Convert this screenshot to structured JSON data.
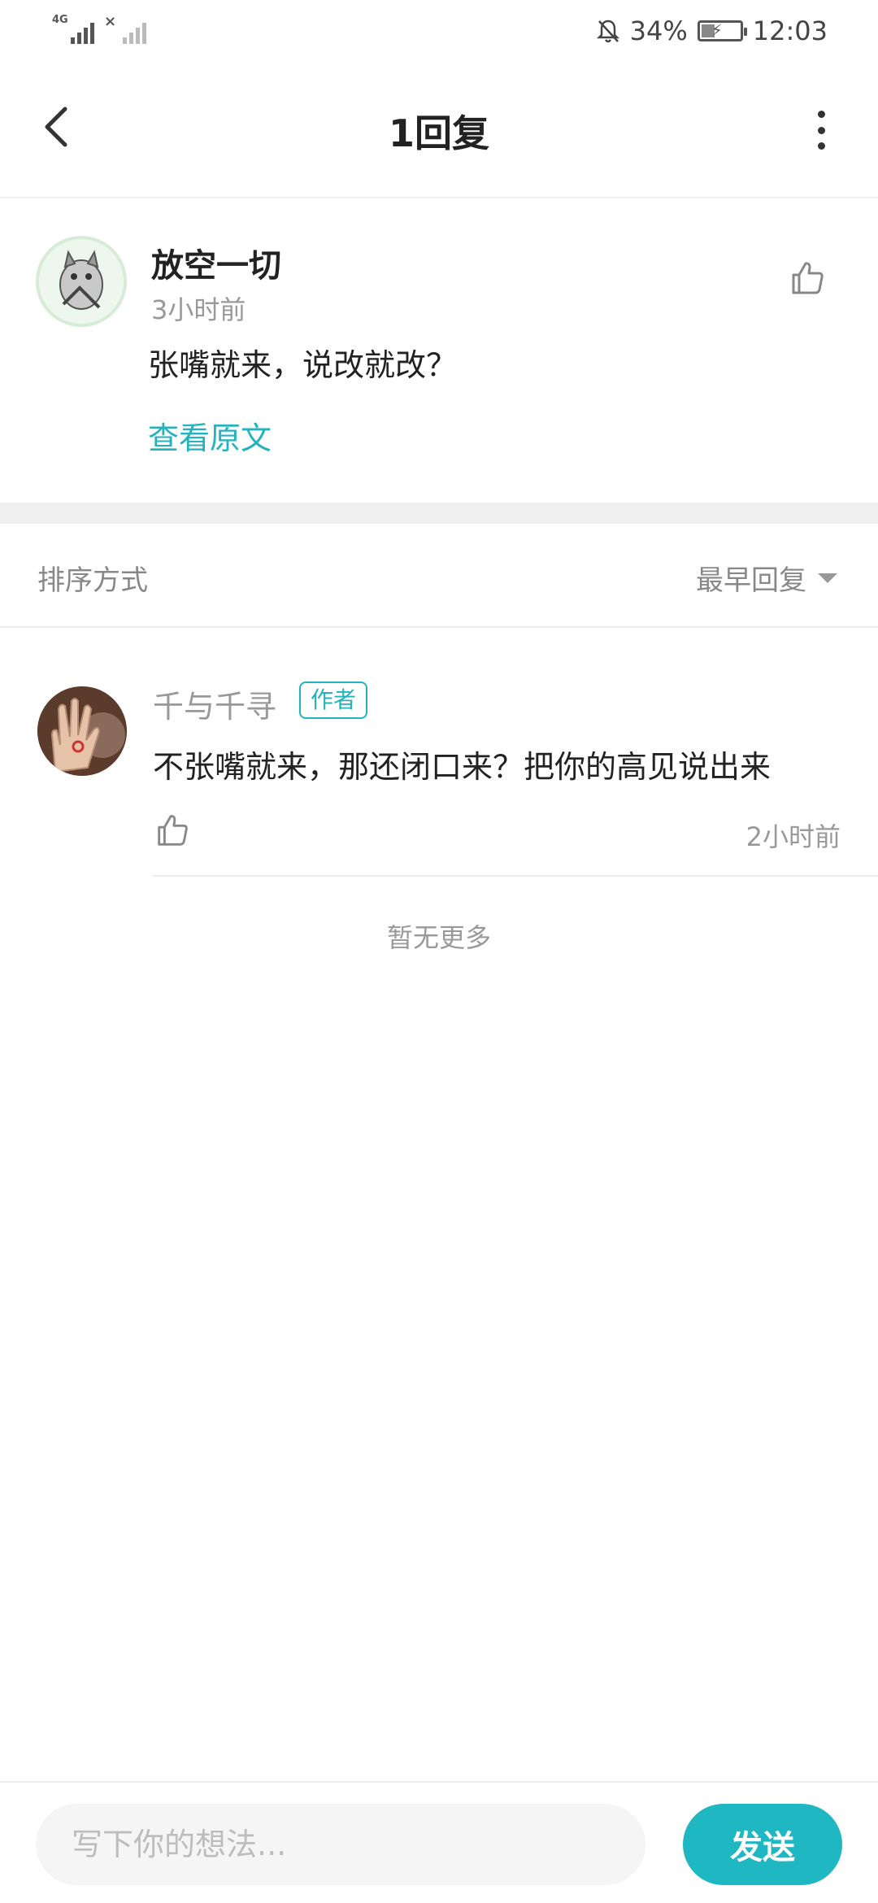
{
  "status_bar": {
    "network_label": "4G",
    "battery_percent": "34%",
    "battery_level": 0.34,
    "time": "12:03",
    "icons": [
      "signal-icon",
      "no-signal-icon",
      "mute-bell-icon",
      "battery-charging-icon"
    ]
  },
  "header": {
    "title": "1回复",
    "back_icon": "chevron-left-icon",
    "more_icon": "more-vertical-icon"
  },
  "main_comment": {
    "author": "放空一切",
    "time": "3小时前",
    "text": "张嘴就来，说改就改？",
    "view_original": "查看原文",
    "like_icon": "thumbs-up-icon"
  },
  "sort": {
    "label": "排序方式",
    "selected": "最早回复"
  },
  "replies": [
    {
      "author": "千与千寻",
      "badge": "作者",
      "text": "不张嘴就来，那还闭口来？把你的高见说出来",
      "time": "2小时前"
    }
  ],
  "no_more": "暂无更多",
  "composer": {
    "placeholder": "写下你的想法...",
    "send_label": "发送"
  },
  "colors": {
    "accent": "#1fb7c2",
    "text_primary": "#222222",
    "text_secondary": "#999999"
  }
}
